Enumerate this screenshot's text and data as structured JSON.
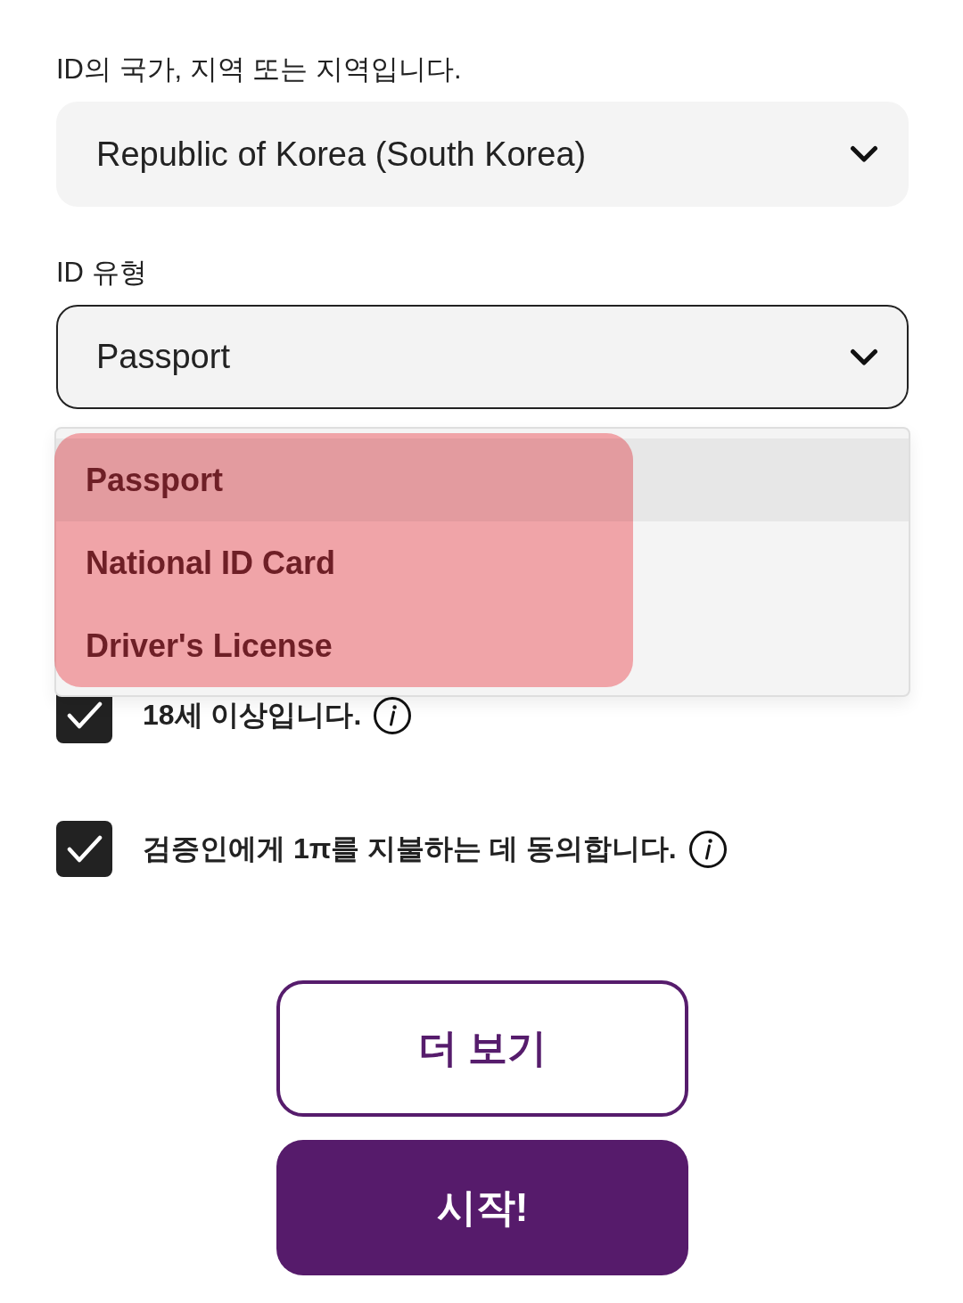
{
  "country_field": {
    "label": "ID의 국가, 지역 또는 지역입니다.",
    "value": "Republic of Korea (South Korea)",
    "focused": false
  },
  "id_type_field": {
    "label": "ID 유형",
    "value": "Passport",
    "focused": true
  },
  "id_type_menu": {
    "highlighted": true,
    "options": [
      {
        "label": "Passport",
        "selected": true
      },
      {
        "label": "National ID Card",
        "selected": false
      },
      {
        "label": "Driver's License",
        "selected": false
      }
    ]
  },
  "checkboxes": [
    {
      "label": "18세 이상입니다.",
      "checked": true
    },
    {
      "label": "검증인에게 1π를 지불하는 데 동의합니다.",
      "checked": true
    }
  ],
  "buttons": [
    {
      "label": "더 보기",
      "kind": "outline"
    },
    {
      "label": "시작!",
      "kind": "filled"
    }
  ]
}
